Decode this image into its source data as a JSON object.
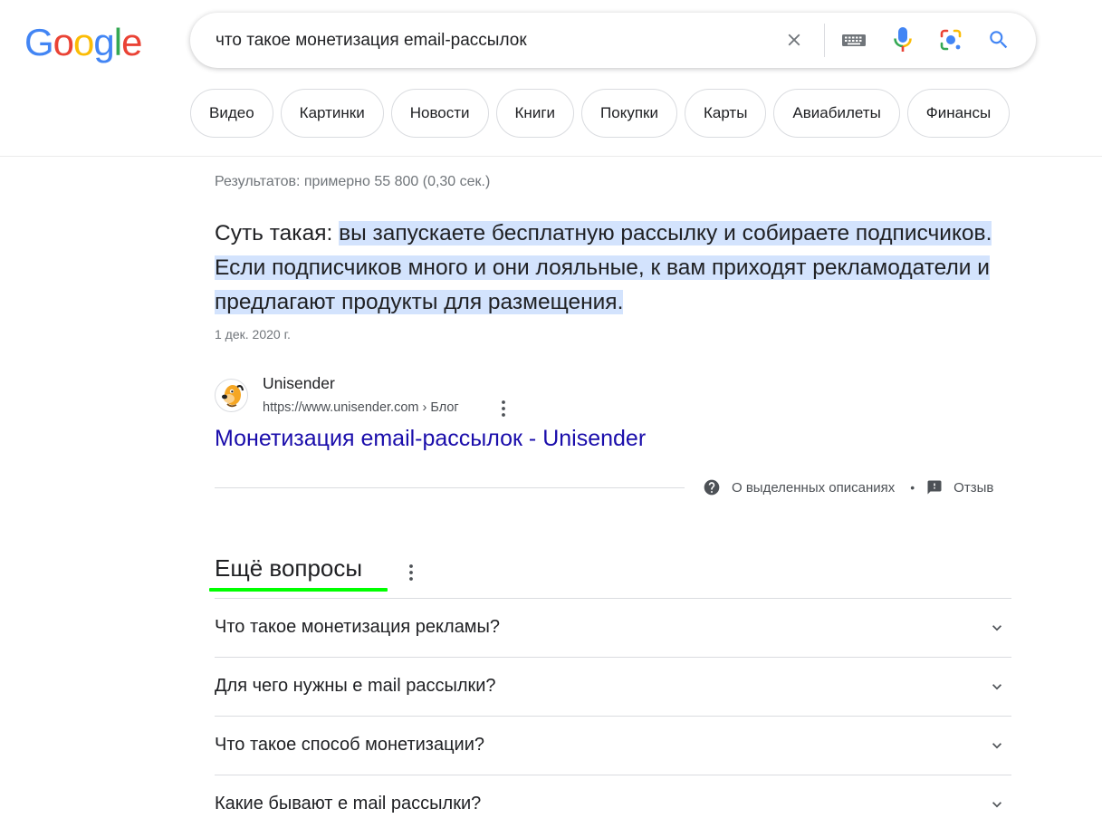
{
  "logo": {
    "letters": [
      "G",
      "o",
      "o",
      "g",
      "l",
      "e"
    ],
    "colors": [
      "#4285F4",
      "#EA4335",
      "#FBBC05",
      "#4285F4",
      "#34A853",
      "#EA4335"
    ]
  },
  "search": {
    "query": "что такое монетизация email-рассылок",
    "icons": [
      "close-icon",
      "keyboard-icon",
      "mic-icon",
      "lens-icon",
      "search-icon"
    ]
  },
  "chips": [
    "Видео",
    "Картинки",
    "Новости",
    "Книги",
    "Покупки",
    "Карты",
    "Авиабилеты",
    "Финансы"
  ],
  "results": {
    "stats": "Результатов: примерно 55 800 (0,30 сек.)",
    "snippet": {
      "lead": "Суть такая: ",
      "highlighted_1": "вы запускаете бесплатную рассылку и собираете подписчиков.",
      "gap": " ",
      "highlighted_2": "Если подписчиков много и они лояльные, к вам приходят рекламодатели и предлагают продукты для размещения",
      "tail": ".",
      "date": "1 дек. 2020 г."
    },
    "source": {
      "site_name": "Unisender",
      "url": "https://www.unisender.com › Блог"
    },
    "link_title": "Монетизация email-рассылок - Unisender",
    "about_label": "О выделенных описаниях",
    "separator": "•",
    "feedback_label": "Отзыв"
  },
  "paa": {
    "title": "Ещё вопросы",
    "underline_color": "#00ff00",
    "questions": [
      "Что такое монетизация рекламы?",
      "Для чего нужны е mail рассылки?",
      "Что такое способ монетизации?",
      "Какие бывают е mail рассылки?"
    ]
  },
  "colors": {
    "link": "#1a0dab",
    "highlight": "#d3e3fd",
    "text": "#202124",
    "muted": "#70757a"
  }
}
